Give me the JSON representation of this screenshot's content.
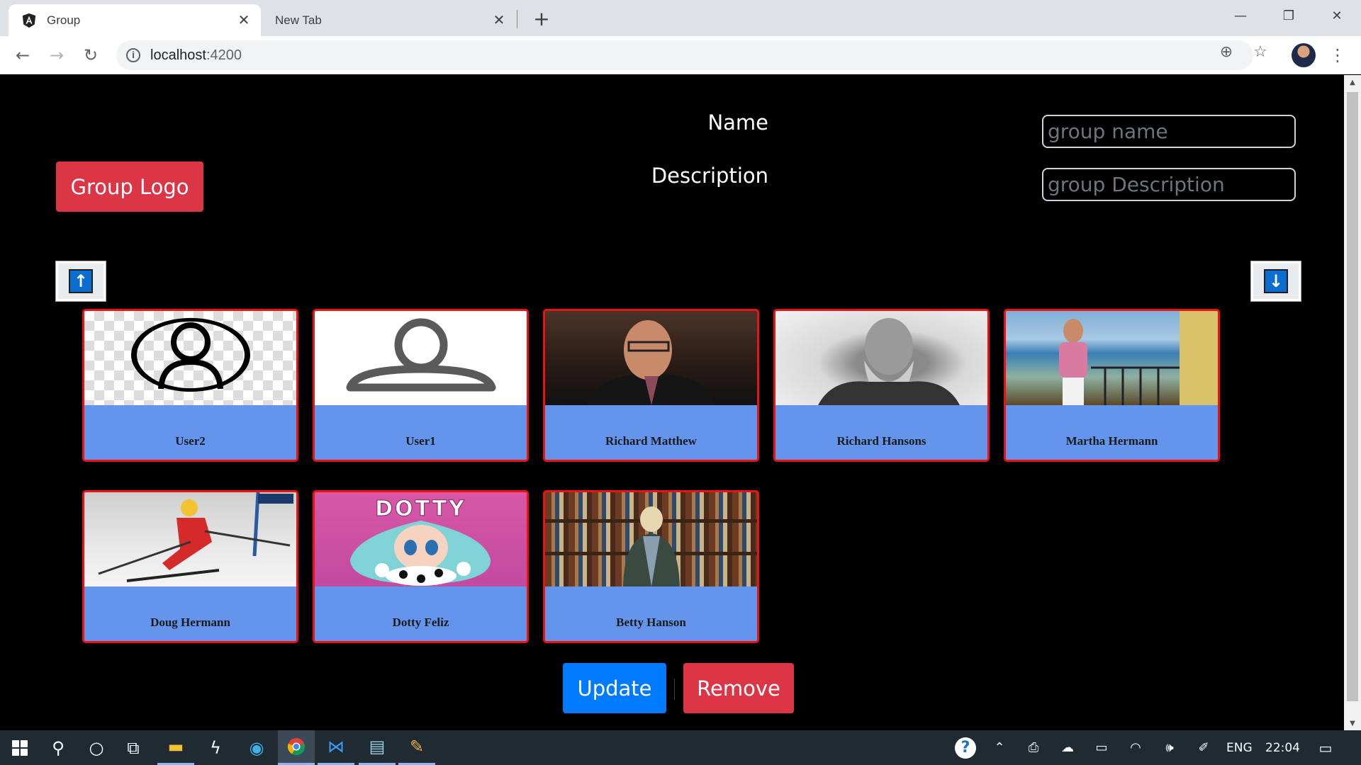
{
  "browser": {
    "tabs": [
      {
        "title": "Group",
        "active": true
      },
      {
        "title": "New Tab",
        "active": false
      }
    ],
    "url_host": "localhost",
    "url_port": ":4200"
  },
  "form": {
    "logo_button": "Group Logo",
    "name_label": "Name",
    "name_placeholder": "group name",
    "description_label": "Description",
    "description_placeholder": "group Description"
  },
  "members": [
    {
      "name": "User2"
    },
    {
      "name": "User1"
    },
    {
      "name": "Richard Matthew"
    },
    {
      "name": "Richard Hansons"
    },
    {
      "name": "Martha Hermann"
    },
    {
      "name": "Doug Hermann"
    },
    {
      "name": "Dotty Feliz"
    },
    {
      "name": "Betty Hanson"
    }
  ],
  "dotty_banner": "DOTTY",
  "actions": {
    "update": "Update",
    "remove": "Remove"
  },
  "taskbar": {
    "language": "ENG",
    "time": "22:04"
  },
  "colors": {
    "card_border": "#ee1111",
    "card_footer": "#6495ed",
    "danger": "#dc3545",
    "primary": "#007bff"
  }
}
